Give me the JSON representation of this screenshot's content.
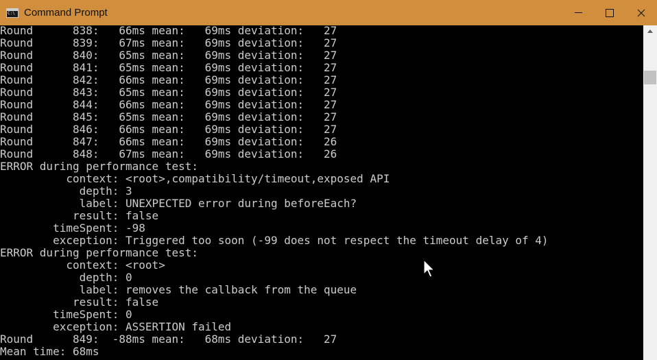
{
  "window": {
    "title": "Command Prompt",
    "controls": {
      "minimize": "minimize",
      "maximize": "maximize",
      "close": "close"
    }
  },
  "console": {
    "lines": [
      "Round      838:   66ms mean:   69ms deviation:   27",
      "Round      839:   67ms mean:   69ms deviation:   27",
      "Round      840:   65ms mean:   69ms deviation:   27",
      "Round      841:   65ms mean:   69ms deviation:   27",
      "Round      842:   66ms mean:   69ms deviation:   27",
      "Round      843:   65ms mean:   69ms deviation:   27",
      "Round      844:   66ms mean:   69ms deviation:   27",
      "Round      845:   65ms mean:   69ms deviation:   27",
      "Round      846:   66ms mean:   69ms deviation:   27",
      "Round      847:   66ms mean:   69ms deviation:   26",
      "Round      848:   67ms mean:   69ms deviation:   26",
      "ERROR during performance test:",
      "          context: <root>,compatibility/timeout,exposed API",
      "            depth: 3",
      "            label: UNEXPECTED error during beforeEach?",
      "           result: false",
      "        timeSpent: -98",
      "        exception: Triggered too soon (-99 does not respect the timeout delay of 4)",
      "ERROR during performance test:",
      "          context: <root>",
      "            depth: 0",
      "            label: removes the callback from the queue",
      "           result: false",
      "        timeSpent: 0",
      "        exception: ASSERTION failed",
      "Round      849:  -88ms mean:   68ms deviation:   27",
      "Mean time: 68ms"
    ]
  },
  "icons": {
    "app": "cmd-icon",
    "cursor": "mouse-pointer-icon"
  },
  "colors": {
    "titlebar": "#d18e3c",
    "background": "#000000",
    "text": "#cccccc"
  }
}
